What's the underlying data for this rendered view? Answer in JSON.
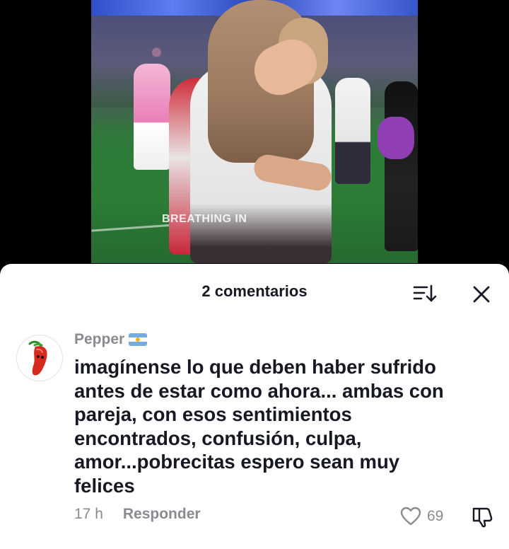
{
  "video": {
    "overlay_caption": "BREATHING IN"
  },
  "comments_sheet": {
    "title": "2 comentarios",
    "sort_icon": "sort-icon",
    "close_icon": "close-icon"
  },
  "comment": {
    "username": "Pepper",
    "flag": "argentina-flag-icon",
    "text": "imagínense lo que deben haber sufrido\nantes de estar como ahora... ambas con\npareja, con esos sentimientos\nencontrados, confusión, culpa,\namor...pobrecitas espero sean muy\nfelices",
    "time": "17 h",
    "reply_label": "Responder",
    "like_count": "69",
    "like_icon": "heart-icon",
    "dislike_icon": "dislike-icon"
  },
  "colors": {
    "text_primary": "#161823",
    "text_secondary": "#8a8b91",
    "sheet_background": "#ffffff",
    "page_background": "#000000"
  }
}
